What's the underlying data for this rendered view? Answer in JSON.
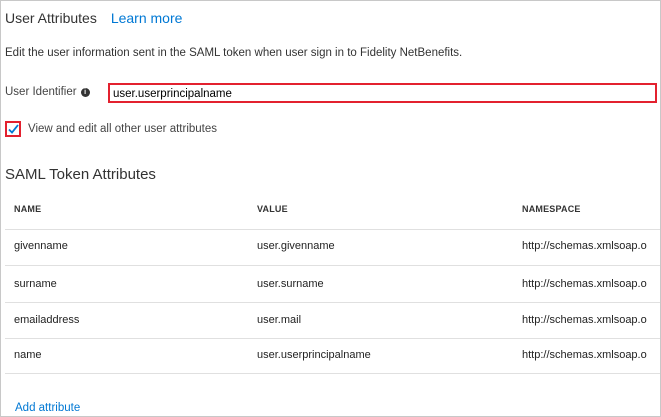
{
  "header": {
    "title": "User Attributes",
    "learn_more": "Learn more"
  },
  "description": "Edit the user information sent in the SAML token when user sign in to Fidelity NetBenefits.",
  "user_identifier": {
    "label": "User Identifier",
    "value": "user.userprincipalname"
  },
  "view_all": {
    "label": "View and edit all other user attributes",
    "checked": true
  },
  "saml": {
    "title": "SAML Token Attributes",
    "columns": [
      "NAME",
      "VALUE",
      "NAMESPACE"
    ],
    "rows": [
      {
        "name": "givenname",
        "value": "user.givenname",
        "namespace": "http://schemas.xmlsoap.o"
      },
      {
        "name": "surname",
        "value": "user.surname",
        "namespace": "http://schemas.xmlsoap.o"
      },
      {
        "name": "emailaddress",
        "value": "user.mail",
        "namespace": "http://schemas.xmlsoap.o"
      },
      {
        "name": "name",
        "value": "user.userprincipalname",
        "namespace": "http://schemas.xmlsoap.o"
      }
    ]
  },
  "add_attribute": "Add attribute",
  "colors": {
    "accent": "#0078d4",
    "highlight": "#e3212f"
  }
}
